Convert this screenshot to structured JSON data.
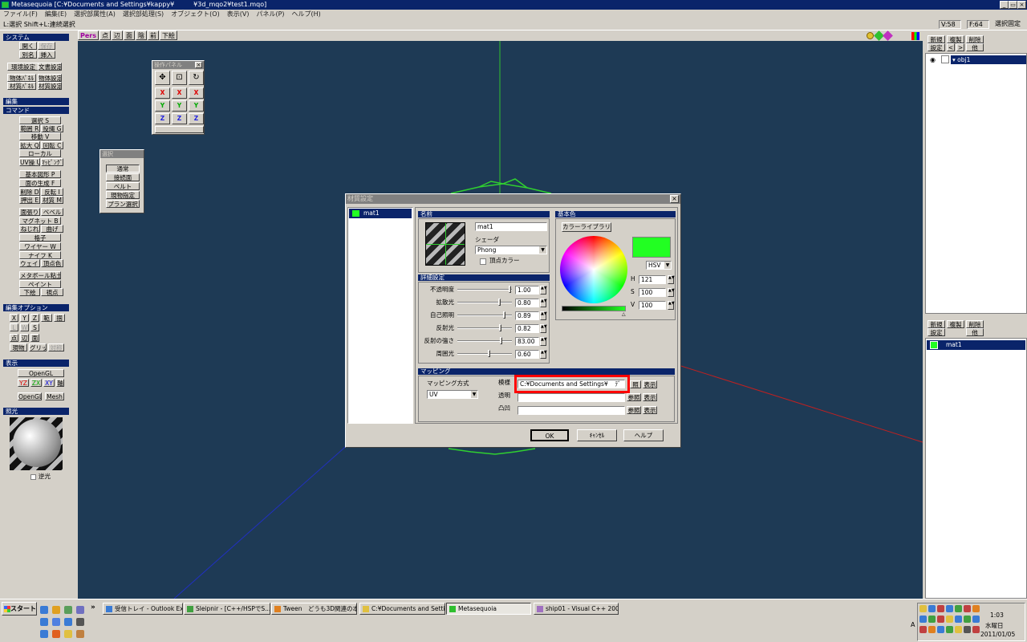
{
  "window": {
    "title": "Metasequoia [C:¥Documents and Settings¥kappy¥　　　¥3d_mqo2¥test1.mqo]"
  },
  "menu": [
    "ファイル(F)",
    "編集(E)",
    "選択部属性(A)",
    "選択部処理(S)",
    "オブジェクト(O)",
    "表示(V)",
    "パネル(P)",
    "ヘルプ(H)"
  ],
  "hint": "L:選択 Shift+L:連続選択",
  "status": {
    "v": "V:58",
    "f": "F:64",
    "mode": "選択固定"
  },
  "left_panel": {
    "system_title": "システム",
    "system_buttons": [
      "開く",
      "保存",
      "別名",
      "挿入",
      "環境設定",
      "文書設定",
      "物体ﾊﾟﾈﾙ",
      "物体設定",
      "材質ﾊﾟﾈﾙ",
      "材質設定"
    ],
    "edit_title": "編集",
    "command_title": "コマンド",
    "command_buttons": [
      "選択 S",
      "範囲 R",
      "投縄 G",
      "移動 V",
      "拡大 Q",
      "回転 C",
      "ローカル",
      "UV操 U",
      "ﾏｯﾋﾟﾝｸﾞ",
      "基本図形 P",
      "面の生成 F",
      "削除 D",
      "反転 I",
      "押出 E",
      "材質 M",
      "面張り",
      "ベベル",
      "マグネット B",
      "ねじれ",
      "曲げ",
      "格子",
      "ワイヤー W",
      "ナイフ K",
      "ウェイト",
      "頂点色",
      "メタボール粘土",
      "ペイント",
      "下絵",
      "視点"
    ],
    "edit_option_title": "編集オプション",
    "edit_option_buttons": [
      "X",
      "Y",
      "Z",
      "範",
      "掴",
      "L",
      "W",
      "S",
      "点",
      "辺",
      "面",
      "現物",
      "グリッド",
      "対称"
    ],
    "display_title": "表示",
    "display_buttons": [
      "OpenGL",
      "YZ",
      "ZX",
      "XY",
      "軸",
      "OpenGL",
      "Mesh"
    ],
    "light_title": "照光",
    "backlight_label": "逆光"
  },
  "view_tabs": [
    "Pers",
    "点",
    "辺",
    "面",
    "陰",
    "前",
    "下絵"
  ],
  "operation_panel": {
    "title": "操作パネル",
    "axes": [
      "X",
      "Y",
      "Z"
    ]
  },
  "select_panel": {
    "title": "選択",
    "items": [
      "通常",
      "接続面",
      "ベルト",
      "現物指定",
      "プラン選択"
    ]
  },
  "object_panel": {
    "buttons": [
      "新規",
      "複製",
      "削除",
      "設定",
      "<",
      ">",
      "他"
    ],
    "object_name": "obj1"
  },
  "material_panel": {
    "buttons": [
      "新規",
      "複製",
      "削除",
      "設定",
      "他"
    ],
    "material_name": "mat1"
  },
  "material_dialog": {
    "title": "材質設定",
    "list_item": "mat1",
    "name_section": "名前",
    "name_value": "mat1",
    "shader_label": "シェーダ",
    "shader_value": "Phong",
    "vertex_color_label": "頂点カラー",
    "detail_section": "詳細設定",
    "params": [
      {
        "label": "不透明度",
        "value": "1.00",
        "level": 1.0
      },
      {
        "label": "拡散光",
        "value": "0.80",
        "level": 0.8
      },
      {
        "label": "自己照明",
        "value": "0.89",
        "level": 0.89
      },
      {
        "label": "反射光",
        "value": "0.82",
        "level": 0.82
      },
      {
        "label": "反射の強さ",
        "value": "83.00",
        "level": 0.83
      },
      {
        "label": "周囲光",
        "value": "0.60",
        "level": 0.6
      }
    ],
    "basecolor_section": "基本色",
    "color_library_button": "カラーライブラリ",
    "color_mode": "HSV",
    "color_swatch": "#22ff22",
    "hsv": [
      {
        "label": "H",
        "value": "121"
      },
      {
        "label": "S",
        "value": "100"
      },
      {
        "label": "V",
        "value": "100"
      }
    ],
    "mapping_section": "マッピング",
    "mapping_method_label": "マッピング方式",
    "mapping_method_value": "UV",
    "texture_label": "模様",
    "texture_path": "C:¥Documents and Settings¥",
    "texture_path_tail": "ﾃﾞ",
    "transparency_label": "透明",
    "bump_label": "凸凹",
    "ref_button": "参照",
    "show_button": "表示",
    "ref_short": "照",
    "ok": "OK",
    "cancel": "ｷｬﾝｾﾙ",
    "help": "ヘルプ",
    "highlight_color": "#ff0000"
  },
  "taskbar": {
    "start": "スタート",
    "tasks": [
      "受信トレイ - Outlook Exp...",
      "Sleipnir - [C++/HSPでS...",
      "Tween　どうも3D関連の本...",
      "C:¥Documents and Setti...",
      "Metasequoia",
      "ship01 - Visual C++ 200..."
    ],
    "clock_time": "1:03",
    "clock_day": "水曜日",
    "clock_date": "2011/01/05",
    "tray_label": "A"
  }
}
